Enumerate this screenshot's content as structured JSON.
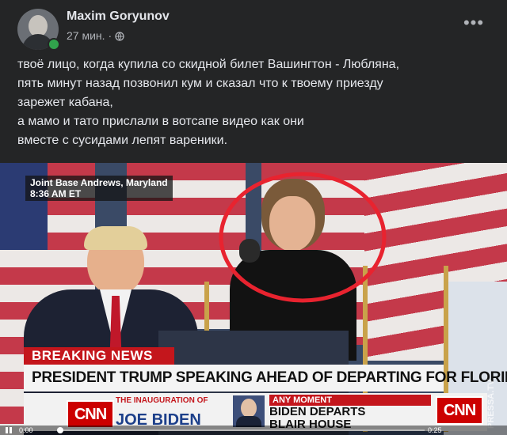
{
  "post": {
    "author": "Maxim Goryunov",
    "time": "27 мин.",
    "separator": "·",
    "more_label": "•••",
    "text_lines": [
      "твоё лицо, когда купила со скидной билет Вашингтон - Любляна,",
      "пять минут назад позвонил кум и сказал что к твоему приезду",
      "зарежет кабана,",
      "а мамо и тато прислали в вотсапе видео как они",
      "вместе с сусидами лепят вареники."
    ]
  },
  "video": {
    "location": "Joint Base Andrews, Maryland",
    "clock": "8:36 AM ET",
    "breaking_label": "BREAKING NEWS",
    "headline": "PRESIDENT TRUMP SPEAKING AHEAD OF DEPARTING FOR FLORIDA",
    "cnn_logo": "CNN",
    "inauguration_small": "THE INAUGURATION OF",
    "inauguration_big": "JOE BIDEN",
    "any_moment": "ANY MOMENT",
    "biden_departs": "BIDEN DEPARTS",
    "blair_house": "BLAIR HOUSE",
    "watermark": "PRESSA.TV",
    "current_time": "0:00",
    "total_time": "0:25",
    "progress": 0.0
  },
  "colors": {
    "highlight_circle": "#e8232f",
    "cnn_red": "#cc0000",
    "online_green": "#31a24c"
  },
  "icons": {
    "globe": "globe-icon",
    "more": "more-icon",
    "pause": "pause-icon"
  }
}
